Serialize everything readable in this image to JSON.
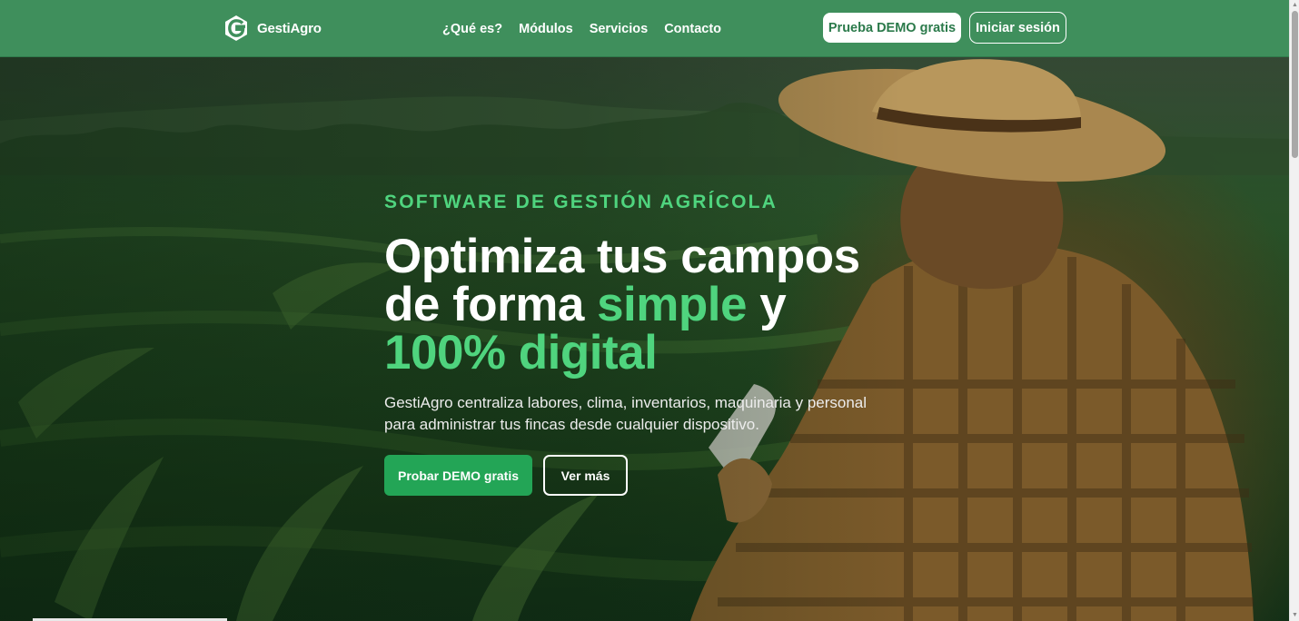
{
  "brand": {
    "name": "GestiAgro",
    "logo_icon": "g-leaf-logo-icon",
    "header_color": "#3f8f5c",
    "accent_color": "#4fd47e",
    "button_color": "#23a556"
  },
  "nav": {
    "items": [
      {
        "label": "¿Qué es?"
      },
      {
        "label": "Módulos"
      },
      {
        "label": "Servicios"
      },
      {
        "label": "Contacto"
      }
    ]
  },
  "header_actions": {
    "demo_label": "Prueba DEMO gratis",
    "login_label": "Iniciar sesión"
  },
  "hero": {
    "eyebrow": "SOFTWARE DE GESTIÓN AGRÍCOLA",
    "headline": {
      "line1": "Optimiza tus campos",
      "line2_a": "de forma ",
      "line2_highlight": "simple",
      "line2_b": " y",
      "line3_highlight": "100% digital"
    },
    "lead": "GestiAgro centraliza labores, clima, inventarios, maquinaria y personal para administrar tus fincas desde cualquier dispositivo.",
    "primary_cta": "Probar DEMO gratis",
    "secondary_cta": "Ver más",
    "background_image": "farmer-in-cornfield-with-tablet"
  }
}
